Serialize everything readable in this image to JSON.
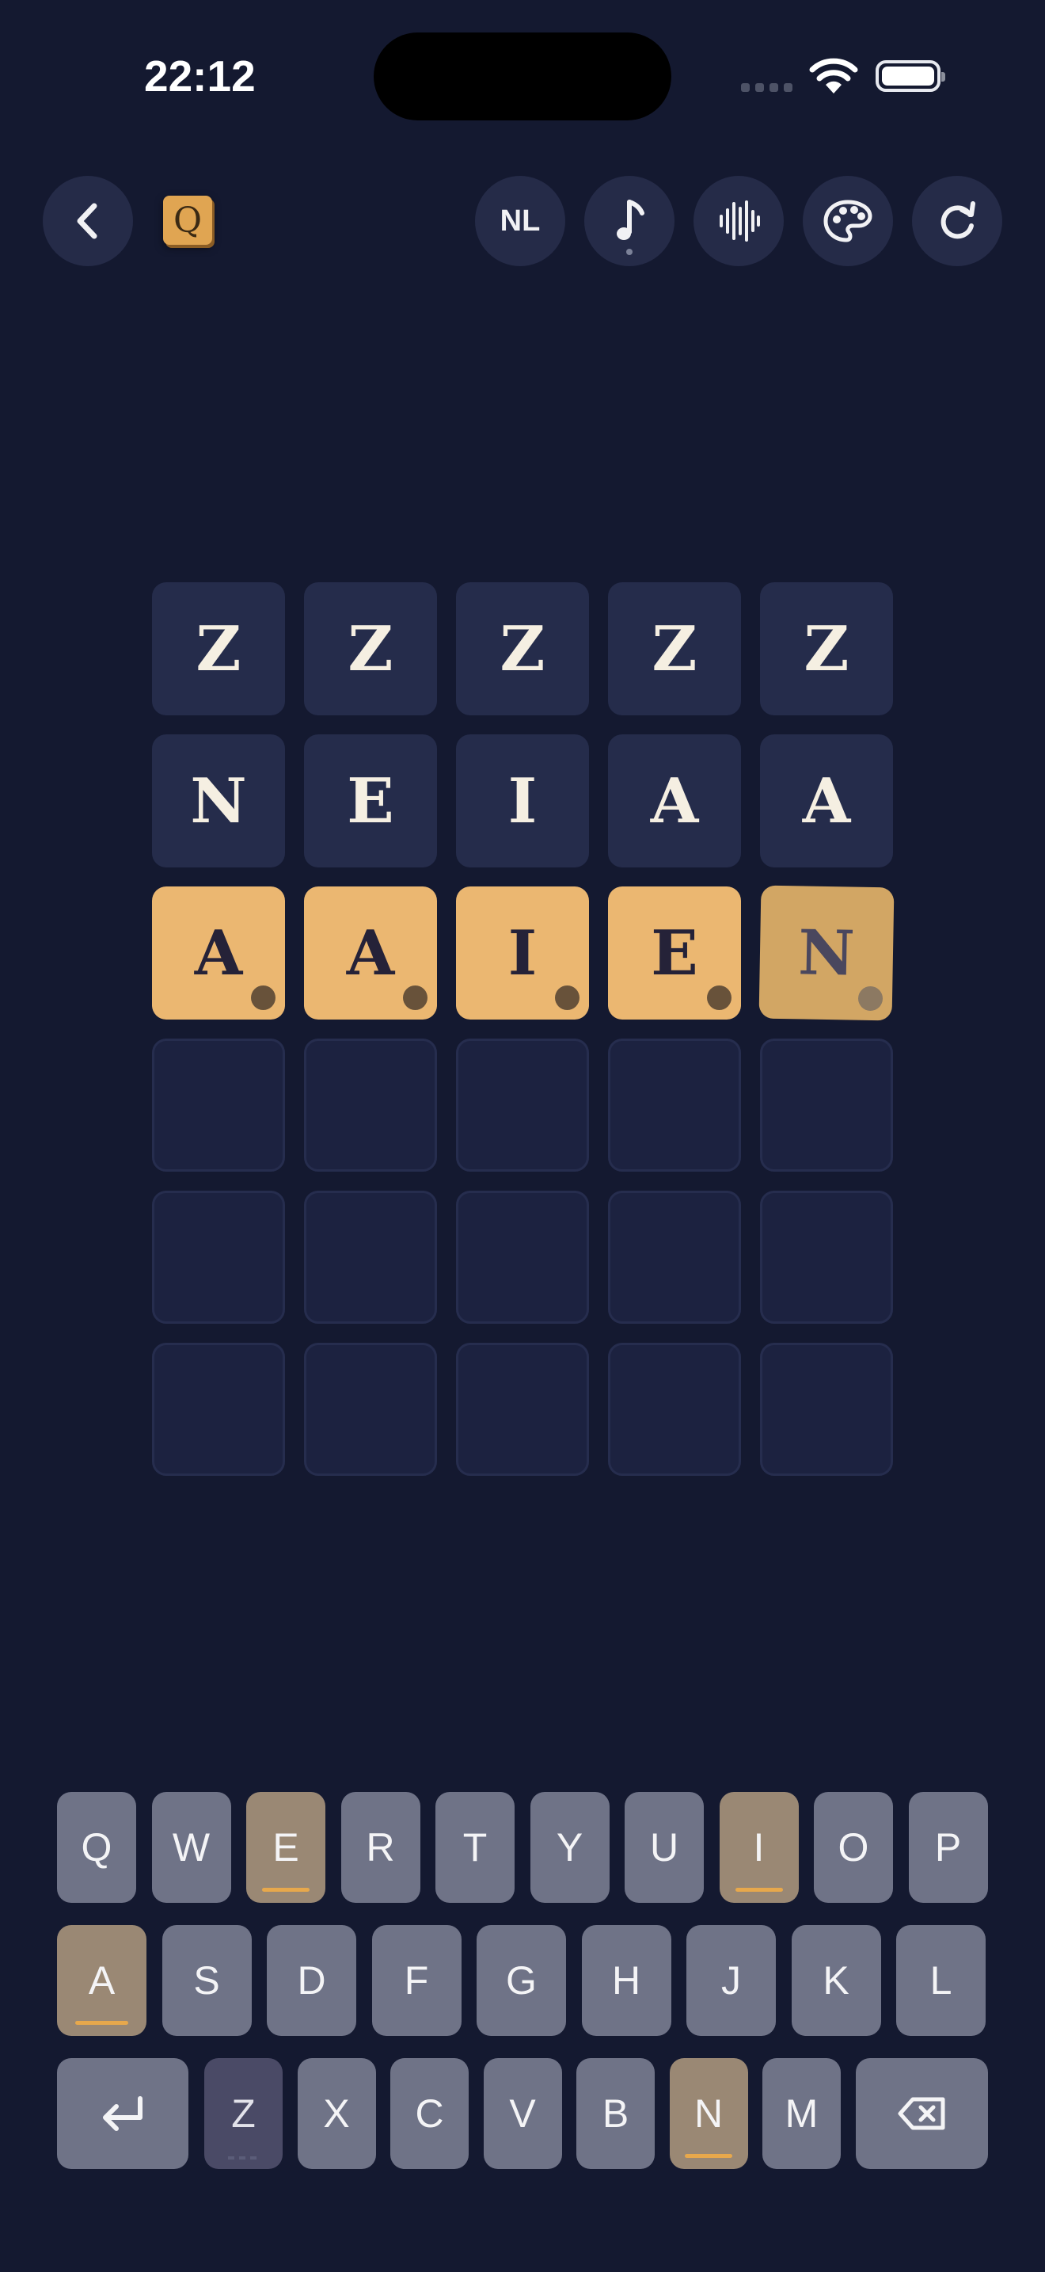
{
  "status": {
    "time": "22:12"
  },
  "header": {
    "logo_letter": "Q",
    "language": "NL",
    "icons": [
      "back-arrow-icon",
      "music-note-icon",
      "sound-wave-icon",
      "palette-icon",
      "refresh-icon"
    ]
  },
  "board": {
    "rows": [
      {
        "state": "filled",
        "letters": [
          "Z",
          "Z",
          "Z",
          "Z",
          "Z"
        ]
      },
      {
        "state": "filled",
        "letters": [
          "N",
          "E",
          "I",
          "A",
          "A"
        ]
      },
      {
        "state": "current",
        "letters": [
          "A",
          "A",
          "I",
          "E",
          "N"
        ]
      },
      {
        "state": "empty",
        "letters": [
          "",
          "",
          "",
          "",
          ""
        ]
      },
      {
        "state": "empty",
        "letters": [
          "",
          "",
          "",
          "",
          ""
        ]
      },
      {
        "state": "empty",
        "letters": [
          "",
          "",
          "",
          "",
          ""
        ]
      }
    ]
  },
  "keyboard": {
    "row1": [
      {
        "k": "Q",
        "s": "normal"
      },
      {
        "k": "W",
        "s": "normal"
      },
      {
        "k": "E",
        "s": "present"
      },
      {
        "k": "R",
        "s": "normal"
      },
      {
        "k": "T",
        "s": "normal"
      },
      {
        "k": "Y",
        "s": "normal"
      },
      {
        "k": "U",
        "s": "normal"
      },
      {
        "k": "I",
        "s": "present"
      },
      {
        "k": "O",
        "s": "normal"
      },
      {
        "k": "P",
        "s": "normal"
      }
    ],
    "row2": [
      {
        "k": "A",
        "s": "present"
      },
      {
        "k": "S",
        "s": "normal"
      },
      {
        "k": "D",
        "s": "normal"
      },
      {
        "k": "F",
        "s": "normal"
      },
      {
        "k": "G",
        "s": "normal"
      },
      {
        "k": "H",
        "s": "normal"
      },
      {
        "k": "J",
        "s": "normal"
      },
      {
        "k": "K",
        "s": "normal"
      },
      {
        "k": "L",
        "s": "normal"
      }
    ],
    "row3": [
      {
        "k": "Z",
        "s": "absent"
      },
      {
        "k": "X",
        "s": "normal"
      },
      {
        "k": "C",
        "s": "normal"
      },
      {
        "k": "V",
        "s": "normal"
      },
      {
        "k": "B",
        "s": "normal"
      },
      {
        "k": "N",
        "s": "present"
      },
      {
        "k": "M",
        "s": "normal"
      }
    ],
    "enter_icon": "enter-icon",
    "backspace_icon": "backspace-icon"
  },
  "colors": {
    "background": "#141930",
    "tile_filled": "#252c4b",
    "tile_current": "#ebb771",
    "key_default": "#6f7387",
    "key_present": "#9a8874",
    "key_absent": "#4a4a66",
    "accent": "#e7a84c"
  }
}
